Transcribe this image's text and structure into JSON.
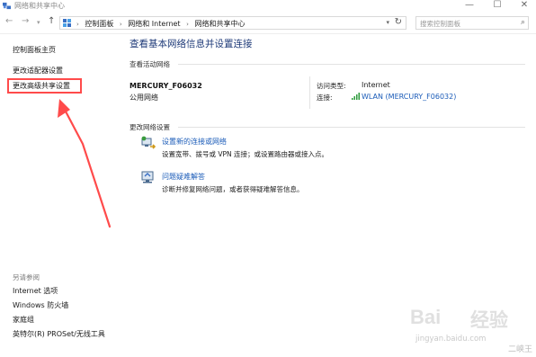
{
  "window": {
    "title": "网络和共享中心",
    "minimize_glyph": "—",
    "maximize_glyph": "☐",
    "close_glyph": "✕"
  },
  "address": {
    "back_glyph": "←",
    "forward_glyph": "→",
    "recent_glyph": "▾",
    "up_glyph": "↑",
    "breadcrumb": [
      "控制面板",
      "网络和 Internet",
      "网络和共享中心"
    ],
    "separator": "›",
    "dropdown_glyph": "▾",
    "refresh_glyph": "↻",
    "search_placeholder": "搜索控制面板",
    "search_glyph": "⌕"
  },
  "sidebar": {
    "home": "控制面板主页",
    "items": [
      "更改适配器设置",
      "更改高级共享设置"
    ],
    "see_also_label": "另请参阅",
    "see_also": [
      "Internet 选项",
      "Windows 防火墙",
      "家庭组",
      "英特尔(R) PROSet/无线工具"
    ]
  },
  "main": {
    "title": "查看基本网络信息并设置连接",
    "active_networks_label": "查看活动网络",
    "network_name": "MERCURY_F06032",
    "network_category": "公用网络",
    "access_type_label": "访问类型:",
    "access_type_value": "Internet",
    "connections_label": "连接:",
    "connections_value": "WLAN (MERCURY_F06032)",
    "change_settings_label": "更改网络设置",
    "tasks": [
      {
        "icon": "network-setup-icon",
        "link": "设置新的连接或网络",
        "desc": "设置宽带、拨号或 VPN 连接；或设置路由器或接入点。"
      },
      {
        "icon": "troubleshoot-icon",
        "link": "问题疑难解答",
        "desc": "诊断并修复网络问题，或者获得疑难解答信息。"
      }
    ]
  },
  "watermark": {
    "brand": "Bai",
    "brand_cn": "经验",
    "url": "jingyan.baidu.com",
    "corner": "二峡王"
  },
  "colors": {
    "link": "#1a5bb8",
    "title": "#1e3a78",
    "annotation": "#ff4b4b"
  }
}
